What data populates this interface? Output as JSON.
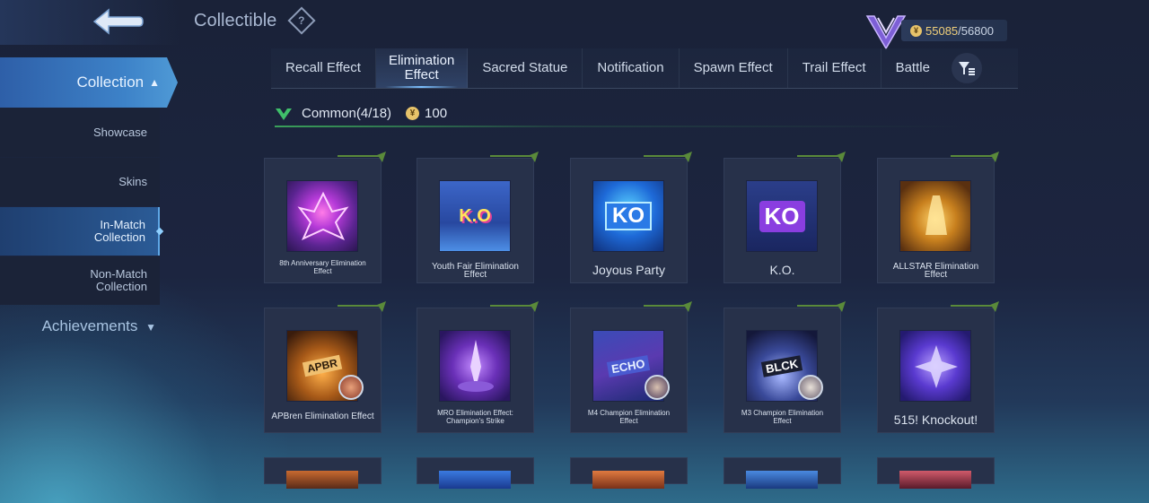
{
  "header": {
    "title": "Collectible",
    "points_current": "55085",
    "points_total": "/56800"
  },
  "sidebar": {
    "collection": "Collection",
    "items": [
      {
        "label": "Showcase"
      },
      {
        "label": "Skins"
      },
      {
        "label": "In-Match Collection",
        "line1": "In-Match",
        "line2": "Collection"
      },
      {
        "label": "Non-Match Collection",
        "line1": "Non-Match",
        "line2": "Collection"
      }
    ],
    "achievements": "Achievements"
  },
  "tabs": [
    {
      "line1": "Recall Effect"
    },
    {
      "line1": "Elimination",
      "line2": "Effect"
    },
    {
      "line1": "Sacred Statue"
    },
    {
      "line1": "Notification"
    },
    {
      "line1": "Spawn Effect"
    },
    {
      "line1": "Trail Effect"
    },
    {
      "line1": "Battle"
    }
  ],
  "section": {
    "rarity": "Common",
    "count": "(4/18)",
    "cost": "100"
  },
  "cards": [
    {
      "line1": "8th Anniversary Elimination",
      "line2": "Effect"
    },
    {
      "line1": "Youth Fair Elimination Effect"
    },
    {
      "line1": "Joyous Party"
    },
    {
      "line1": "K.O."
    },
    {
      "line1": "ALLSTAR Elimination Effect"
    },
    {
      "line1": "APBren Elimination Effect"
    },
    {
      "line1": "MRO Elimination Effect:",
      "line2": "Champion's Strike"
    },
    {
      "line1": "M4 Champion Elimination",
      "line2": "Effect"
    },
    {
      "line1": "M3 Champion Elimination",
      "line2": "Effect"
    },
    {
      "line1": "515! Knockout!"
    }
  ],
  "thumb_text": {
    "youth": "K.O",
    "joyous": "KO",
    "ko": "KO",
    "apbren": "APBR",
    "m4": "ECHO",
    "m3": "BLCK"
  },
  "colors": {
    "accent_blue": "#3d82c8",
    "rarity_green": "#3aa05a",
    "coin_gold": "#e7c36a"
  },
  "icons": {
    "back": "back-arrow-icon",
    "help": "help-icon",
    "filter": "filter-icon",
    "rarity": "green-gem-icon",
    "coin": "coin-icon",
    "emblem": "rank-emblem-icon"
  }
}
